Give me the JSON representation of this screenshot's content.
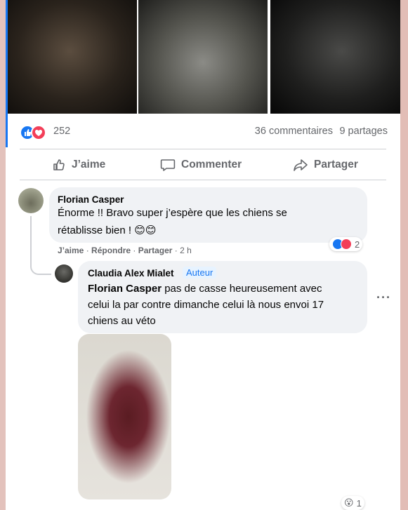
{
  "post": {
    "reactions": {
      "count": "252",
      "icons": [
        "like",
        "love"
      ]
    },
    "comments_count": "36 commentaires",
    "shares_count": "9 partages",
    "actions": {
      "like": "J’aime",
      "comment": "Commenter",
      "share": "Partager"
    }
  },
  "comments": [
    {
      "author": "Florian Casper",
      "text_line1": "Énorme !! Bravo super j’espère que les chiens se",
      "text_line2": "rétablisse bien ! 😊😊",
      "meta": {
        "like": "J’aime",
        "reply": "Répondre",
        "share": "Partager",
        "time": "2 h"
      },
      "reactions": {
        "count": "2",
        "icons": [
          "like",
          "love"
        ]
      }
    }
  ],
  "reply": {
    "author": "Claudia Alex Mialet",
    "badge": "Auteur",
    "mention": "Florian Casper",
    "text_line1": " pas de casse heureusement avec",
    "text_line2": "celui la par contre dimanche celui là nous envoi 17",
    "text_line3": "chiens au véto",
    "more_icon": "···",
    "reactions": {
      "count": "1",
      "icons": [
        "wow"
      ]
    }
  },
  "colors": {
    "accent": "#1877f2",
    "love": "#f33e58",
    "bubble": "#f0f2f5",
    "muted": "#65676b"
  }
}
